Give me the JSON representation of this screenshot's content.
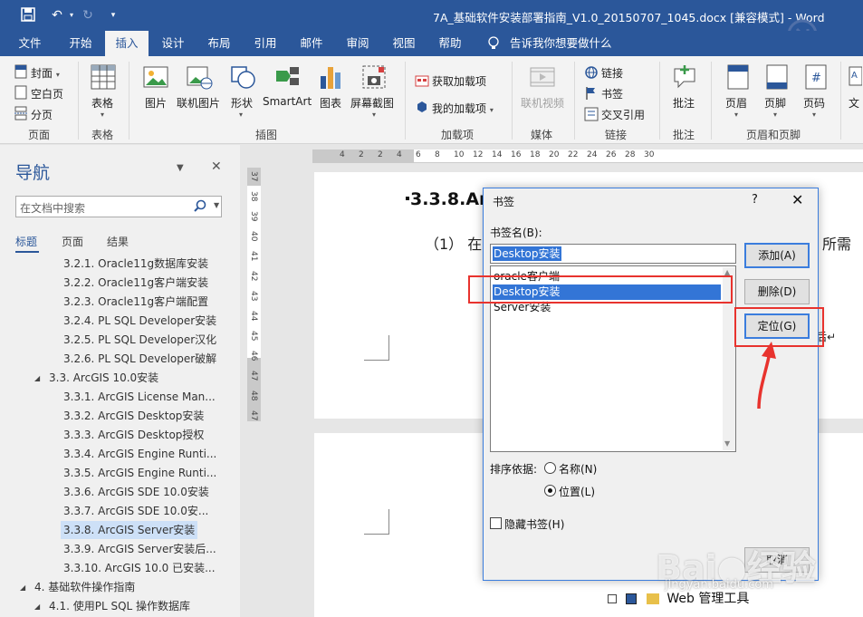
{
  "window": {
    "title": "7A_基础软件安装部署指南_V1.0_20150707_1045.docx [兼容模式] - Word"
  },
  "quick_access": {
    "save_icon": "save-icon",
    "undo_icon": "undo-icon",
    "redo_icon": "redo-icon",
    "customize_icon": "customize-icon"
  },
  "tabs": [
    "文件",
    "开始",
    "插入",
    "设计",
    "布局",
    "引用",
    "邮件",
    "审阅",
    "视图",
    "帮助"
  ],
  "active_tab": "插入",
  "tell_me": "告诉我你想要做什么",
  "ribbon": {
    "pages": {
      "cover": "封面",
      "blank": "空白页",
      "break": "分页",
      "group": "页面"
    },
    "tables": {
      "table": "表格",
      "group": "表格"
    },
    "illustrations": {
      "picture": "图片",
      "online_picture": "联机图片",
      "shapes": "形状",
      "smartart": "SmartArt",
      "chart": "图表",
      "screenshot": "屏幕截图",
      "group": "插图"
    },
    "addins": {
      "get": "获取加载项",
      "my": "我的加载项",
      "group": "加载项"
    },
    "media": {
      "online_video": "联机视频",
      "group": "媒体"
    },
    "links": {
      "link": "链接",
      "bookmark": "书签",
      "cross_ref": "交叉引用",
      "group": "链接"
    },
    "comments": {
      "comment": "批注",
      "group": "批注"
    },
    "header_footer": {
      "header": "页眉",
      "footer": "页脚",
      "page_number": "页码",
      "group": "页眉和页脚"
    },
    "text": {
      "text_box": "文"
    }
  },
  "nav_pane": {
    "title": "导航",
    "search_placeholder": "在文档中搜索",
    "tabs": [
      "标题",
      "页面",
      "结果"
    ],
    "items": [
      {
        "label": "3.2.1. Oracle11g数据库安装",
        "level": 3
      },
      {
        "label": "3.2.2. Oracle11g客户端安装",
        "level": 3
      },
      {
        "label": "3.2.3. Oracle11g客户端配置",
        "level": 3
      },
      {
        "label": "3.2.4. PL SQL Developer安装",
        "level": 3
      },
      {
        "label": "3.2.5. PL SQL Developer汉化",
        "level": 3
      },
      {
        "label": "3.2.6. PL SQL Developer破解",
        "level": 3
      },
      {
        "label": "3.3. ArcGIS 10.0安装",
        "level": 2
      },
      {
        "label": "3.3.1. ArcGIS License Man...",
        "level": 3
      },
      {
        "label": "3.3.2. ArcGIS Desktop安装",
        "level": 3
      },
      {
        "label": "3.3.3. ArcGIS Desktop授权",
        "level": 3
      },
      {
        "label": "3.3.4. ArcGIS Engine Runti...",
        "level": 3
      },
      {
        "label": "3.3.5. ArcGIS Engine Runti...",
        "level": 3
      },
      {
        "label": "3.3.6. ArcGIS SDE 10.0安装",
        "level": 3
      },
      {
        "label": "3.3.7. ArcGIS SDE 10.0安...",
        "level": 3
      },
      {
        "label": "3.3.8. ArcGIS Server安装",
        "level": 3
      },
      {
        "label": "3.3.9. ArcGIS Server安装后...",
        "level": 3
      },
      {
        "label": "3.3.10. ArcGIS 10.0 已安装...",
        "level": 3
      },
      {
        "label": "4. 基础软件操作指南",
        "level": 1
      },
      {
        "label": "4.1. 使用PL SQL 操作数据库",
        "level": 2
      }
    ],
    "selected_index": 14
  },
  "ruler": {
    "h_numbers": [
      "4",
      "2",
      "2",
      "4",
      "6",
      "8",
      "10",
      "12",
      "14",
      "16",
      "18",
      "20",
      "22",
      "24",
      "26",
      "28",
      "30"
    ],
    "v_numbers": [
      "37",
      "38",
      "39",
      "40",
      "41",
      "42",
      "43",
      "44",
      "45",
      "46",
      "47",
      "48",
      "47"
    ]
  },
  "document": {
    "heading": "3.3.8.Ar",
    "para_start": "（1）  在",
    "para_end": "所需",
    "para_tail": "后↵",
    "tree_label": "Web 管理工具"
  },
  "dialog": {
    "title": "书签",
    "help": "?",
    "close": "✕",
    "name_label": "书签名(B):",
    "name_value": "Desktop安装",
    "list": [
      "oracle客户端",
      "Desktop安装",
      "Server安装"
    ],
    "list_selected": 1,
    "buttons": {
      "add": "添加(A)",
      "delete": "删除(D)",
      "goto": "定位(G)",
      "cancel": "取消"
    },
    "sort_label": "排序依据:",
    "sort_name": "名称(N)",
    "sort_location": "位置(L)",
    "sort_selected": "位置(L)",
    "hidden_label": "隐藏书签(H)",
    "hidden_checked": false
  },
  "annotation": {
    "color": "#e8332e"
  },
  "watermark": {
    "logo": "Baidu经验",
    "url": "jingyan.baidu.com"
  },
  "colors": {
    "word_blue": "#2b579a",
    "selection_blue": "#3375d6"
  }
}
